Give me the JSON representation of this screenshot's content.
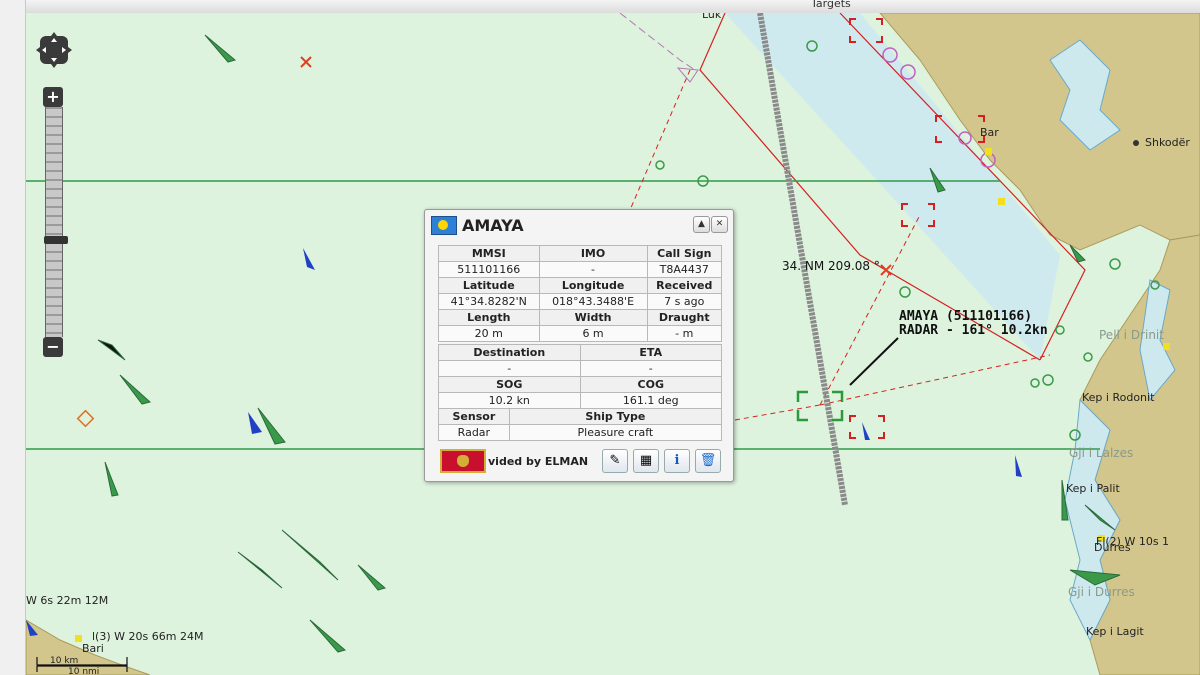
{
  "window": {
    "title": "Targets"
  },
  "popup": {
    "vessel_name": "AMAYA",
    "flag_icon": "palau-flag-icon",
    "table": {
      "r1_h": [
        "MMSI",
        "IMO",
        "Call Sign"
      ],
      "r1_v": [
        "511101166",
        "-",
        "T8A4437"
      ],
      "r2_h": [
        "Latitude",
        "Longitude",
        "Received"
      ],
      "r2_v": [
        "41°34.8282'N",
        "018°43.3488'E",
        "7 s ago"
      ],
      "r3_h": [
        "Length",
        "Width",
        "Draught"
      ],
      "r3_v": [
        "20 m",
        "6 m",
        "- m"
      ],
      "r4_h": [
        "Destination",
        "ETA"
      ],
      "r4_v": [
        "-",
        "-"
      ],
      "r5_h": [
        "SOG",
        "COG"
      ],
      "r5_v": [
        "10.2 kn",
        "161.1 deg"
      ],
      "r6_h": [
        "Sensor",
        "Ship Type"
      ],
      "r6_v": [
        "Radar",
        "Pleasure craft"
      ]
    },
    "provider_text": "vided by ELMAN",
    "provider_flag": "montenegro-flag-icon"
  },
  "overlay": {
    "ship_label_line1": "AMAYA (511101166)",
    "ship_label_line2": "RADAR - 161° 10.2kn",
    "range_bearing": "34.  NM 209.08 °"
  },
  "places": {
    "luk": "Luk",
    "bar": "Bar",
    "shkoder": "Shkodër",
    "pell_i_drinit": "Pell i Drinit",
    "kep_i_rodonit": "Kep i Rodonit",
    "gji_i_lalzes": "Gji i Lalzes",
    "kep_i_palit": "Kep i Palit",
    "durres": "Durres",
    "gji_i_durres": "Gji i Durres",
    "kep_i_lagit": "Kep i Lagit",
    "bari": "Bari"
  },
  "lights": {
    "durres_light": "Fl(2) W 10s 1",
    "bari_light": "l(3) W 20s 66m 24M",
    "left_light": "W 6s 22m 12M"
  },
  "scale": {
    "km": "10 km",
    "nmi": "10 nmi"
  },
  "colors": {
    "sea": "#def3de",
    "land": "#d3c68c",
    "shallow": "#cde9ee",
    "route": "#d62020",
    "grid": "#2e9a4a",
    "target": "#3a9a4a"
  }
}
